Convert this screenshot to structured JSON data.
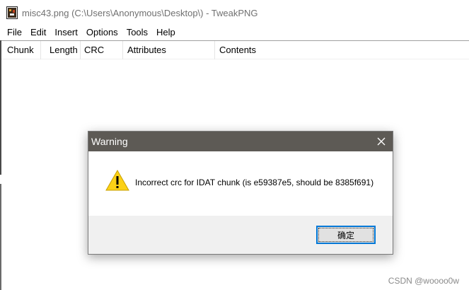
{
  "window": {
    "title": "misc43.png (C:\\Users\\Anonymous\\Desktop\\) - TweakPNG",
    "icon": "tweakpng-app-icon"
  },
  "menu": [
    "File",
    "Edit",
    "Insert",
    "Options",
    "Tools",
    "Help"
  ],
  "table": {
    "columns": [
      "Chunk",
      "Length",
      "CRC",
      "Attributes",
      "Contents"
    ],
    "rows": []
  },
  "dialog": {
    "title": "Warning",
    "close_icon": "close-icon",
    "icon": "warning-triangle-icon",
    "message": "Incorrect crc for IDAT chunk (is e59387e5, should be 8385f691)",
    "ok_label": "确定"
  },
  "watermark": "CSDN @woooo0w",
  "colors": {
    "dialog_titlebar": "#5d5a55",
    "warning_yellow": "#fcd116",
    "focus_blue": "#0078d7"
  }
}
